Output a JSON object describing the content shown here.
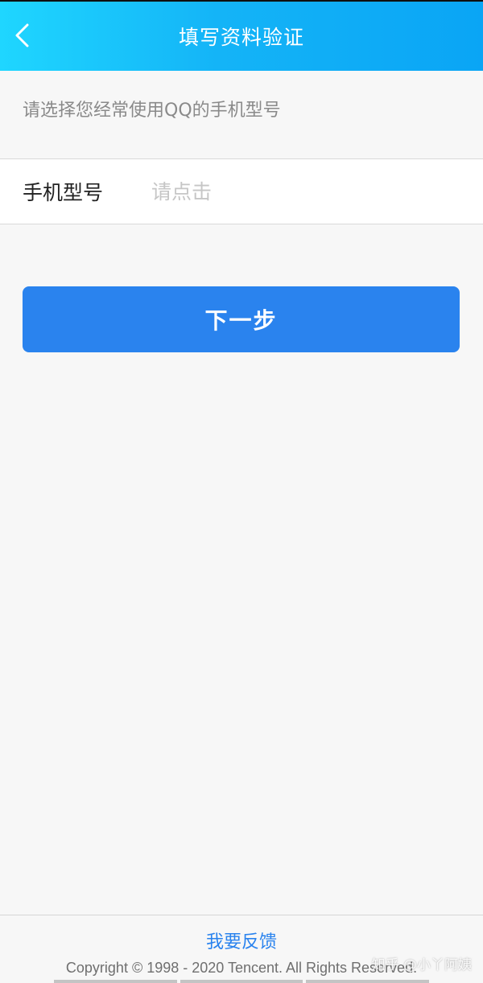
{
  "header": {
    "title": "填写资料验证",
    "back_icon": "chevron-left-icon"
  },
  "hint": "请选择您经常使用QQ的手机型号",
  "form": {
    "label": "手机型号",
    "placeholder": "请点击",
    "value": ""
  },
  "next_button": "下一步",
  "footer": {
    "feedback": "我要反馈",
    "copyright": "Copyright © 1998 - 2020 Tencent. All Rights Reserved."
  },
  "watermark": "知乎 @小丫阿姨",
  "colors": {
    "header_gradient_start": "#1fd6ff",
    "header_gradient_end": "#0aa5f5",
    "accent": "#2a83ee",
    "background": "#f7f7f7"
  }
}
